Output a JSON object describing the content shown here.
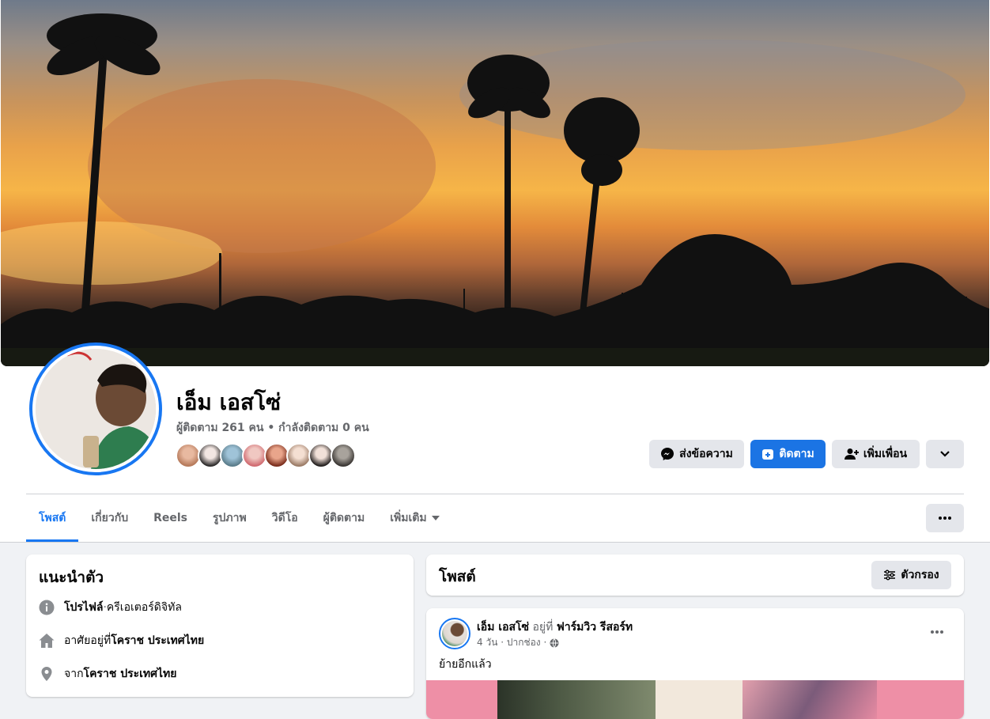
{
  "profile": {
    "name": "เอ็ม เอสโซ่",
    "stats": "ผู้ติดตาม 261 คน • กำลังติดตาม 0 คน"
  },
  "actions": {
    "message_label": "ส่งข้อความ",
    "follow_label": "ติดตาม",
    "add_friend_label": "เพิ่มเพื่อน"
  },
  "tabs": [
    {
      "label": "โพสต์",
      "active": true
    },
    {
      "label": "เกี่ยวกับ"
    },
    {
      "label": "Reels"
    },
    {
      "label": "รูปภาพ"
    },
    {
      "label": "วิดีโอ"
    },
    {
      "label": "ผู้ติดตาม"
    },
    {
      "label": "เพิ่มเติม"
    }
  ],
  "intro": {
    "title": "แนะนำตัว",
    "profile_label": "โปรไฟล์",
    "profile_sep": " · ",
    "profile_category": "ครีเอเตอร์ดิจิทัล",
    "lives_prefix": "อาศัยอยู่ที่ ",
    "lives_place": "โคราช ประเทศไทย",
    "from_prefix": "จาก ",
    "from_place": "โคราช ประเทศไทย"
  },
  "posts_header": {
    "title": "โพสต์",
    "filter_label": "ตัวกรอง"
  },
  "post": {
    "author": "เอ็ม เอสโซ่",
    "at_text": " อยู่ที่ ",
    "place": "ฟาร์มวิว รีสอร์ท",
    "meta": "4 วัน · ปากช่อง ·",
    "body": "ย้ายอีกแล้ว"
  },
  "colors": {
    "accent": "#1877f2",
    "follow_button": "#1b74e4",
    "page_bg": "#f0f2f5",
    "secondary_button": "#e4e6eb"
  }
}
